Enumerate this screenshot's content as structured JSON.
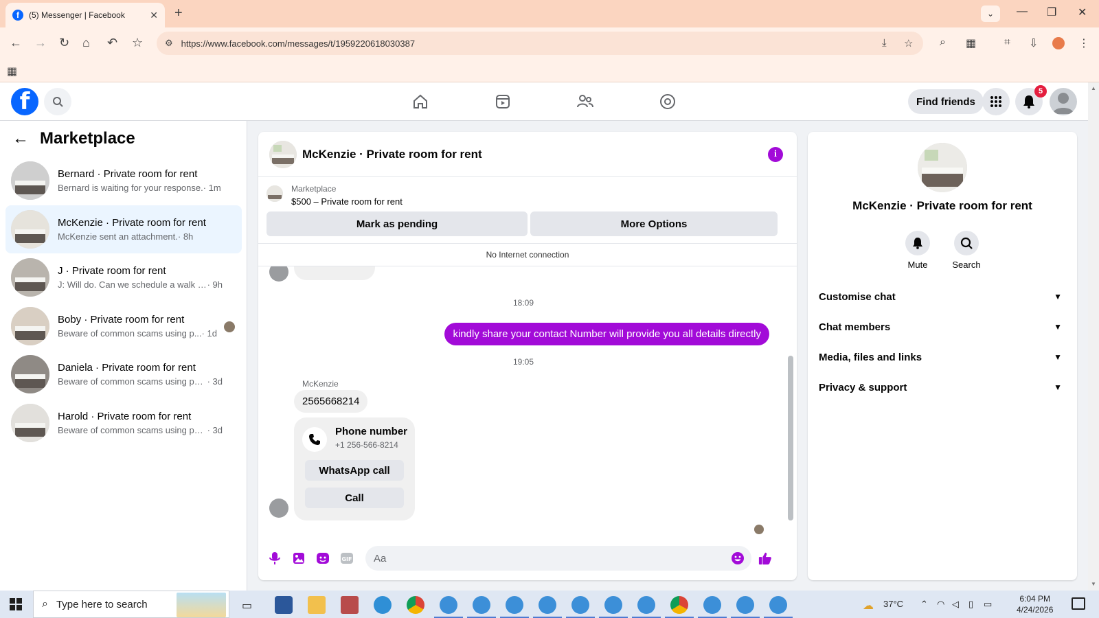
{
  "browser": {
    "tab_title": "(5) Messenger | Facebook",
    "tab_favicon": "f",
    "new_tab": "+",
    "url": "https://www.facebook.com/messages/t/1959220618030387"
  },
  "fb_header": {
    "find_friends_label": "Find friends",
    "notification_count": "5",
    "logo_letter": "f"
  },
  "sidebar": {
    "title": "Marketplace",
    "conversations": [
      {
        "name": "Bernard · Private room for rent",
        "preview": "Bernard is waiting for your response.",
        "time": " · 1m",
        "active": false
      },
      {
        "name": "McKenzie · Private room for rent",
        "preview": "McKenzie sent an attachment.",
        "time": " · 8h",
        "active": true
      },
      {
        "name": "J · Private room for rent",
        "preview": "J: Will do. Can we schedule a walk thr...",
        "time": " · 9h",
        "active": false
      },
      {
        "name": "Boby · Private room for rent",
        "preview": "Beware of common scams using p...",
        "time": " · 1d",
        "active": false
      },
      {
        "name": "Daniela · Private room for rent",
        "preview": "Beware of common scams using pay...",
        "time": " · 3d",
        "active": false
      },
      {
        "name": "Harold · Private room for rent",
        "preview": "Beware of common scams using pay...",
        "time": " · 3d",
        "active": false
      }
    ]
  },
  "chat": {
    "title": "McKenzie · Private room for rent",
    "marketplace_label": "Marketplace",
    "listing": "$500 – Private room for rent",
    "mark_pending_label": "Mark as pending",
    "more_options_label": "More Options",
    "no_internet": "No Internet connection",
    "messages": {
      "time1": "18:09",
      "outgoing": "kindly share your contact Number will provide you all details directly",
      "time2": "19:05",
      "sender": "McKenzie",
      "incoming": "2565668214",
      "phone_card_title": "Phone number",
      "phone_card_number": "+1 256-566-8214",
      "whatsapp_label": "WhatsApp call",
      "call_label": "Call"
    },
    "composer_placeholder": "Aa"
  },
  "info_panel": {
    "name": "McKenzie · Private room for rent",
    "mute_label": "Mute",
    "search_label": "Search",
    "sections": [
      "Customise chat",
      "Chat members",
      "Media, files and links",
      "Privacy & support"
    ]
  },
  "taskbar": {
    "search_placeholder": "Type here to search",
    "weather": "37°C",
    "time": "6:04 PM",
    "date": "4/24/2026"
  },
  "colors": {
    "messenger_purple": "#a20bd8",
    "facebook_blue": "#0866ff",
    "active_row": "#ebf5ff"
  }
}
